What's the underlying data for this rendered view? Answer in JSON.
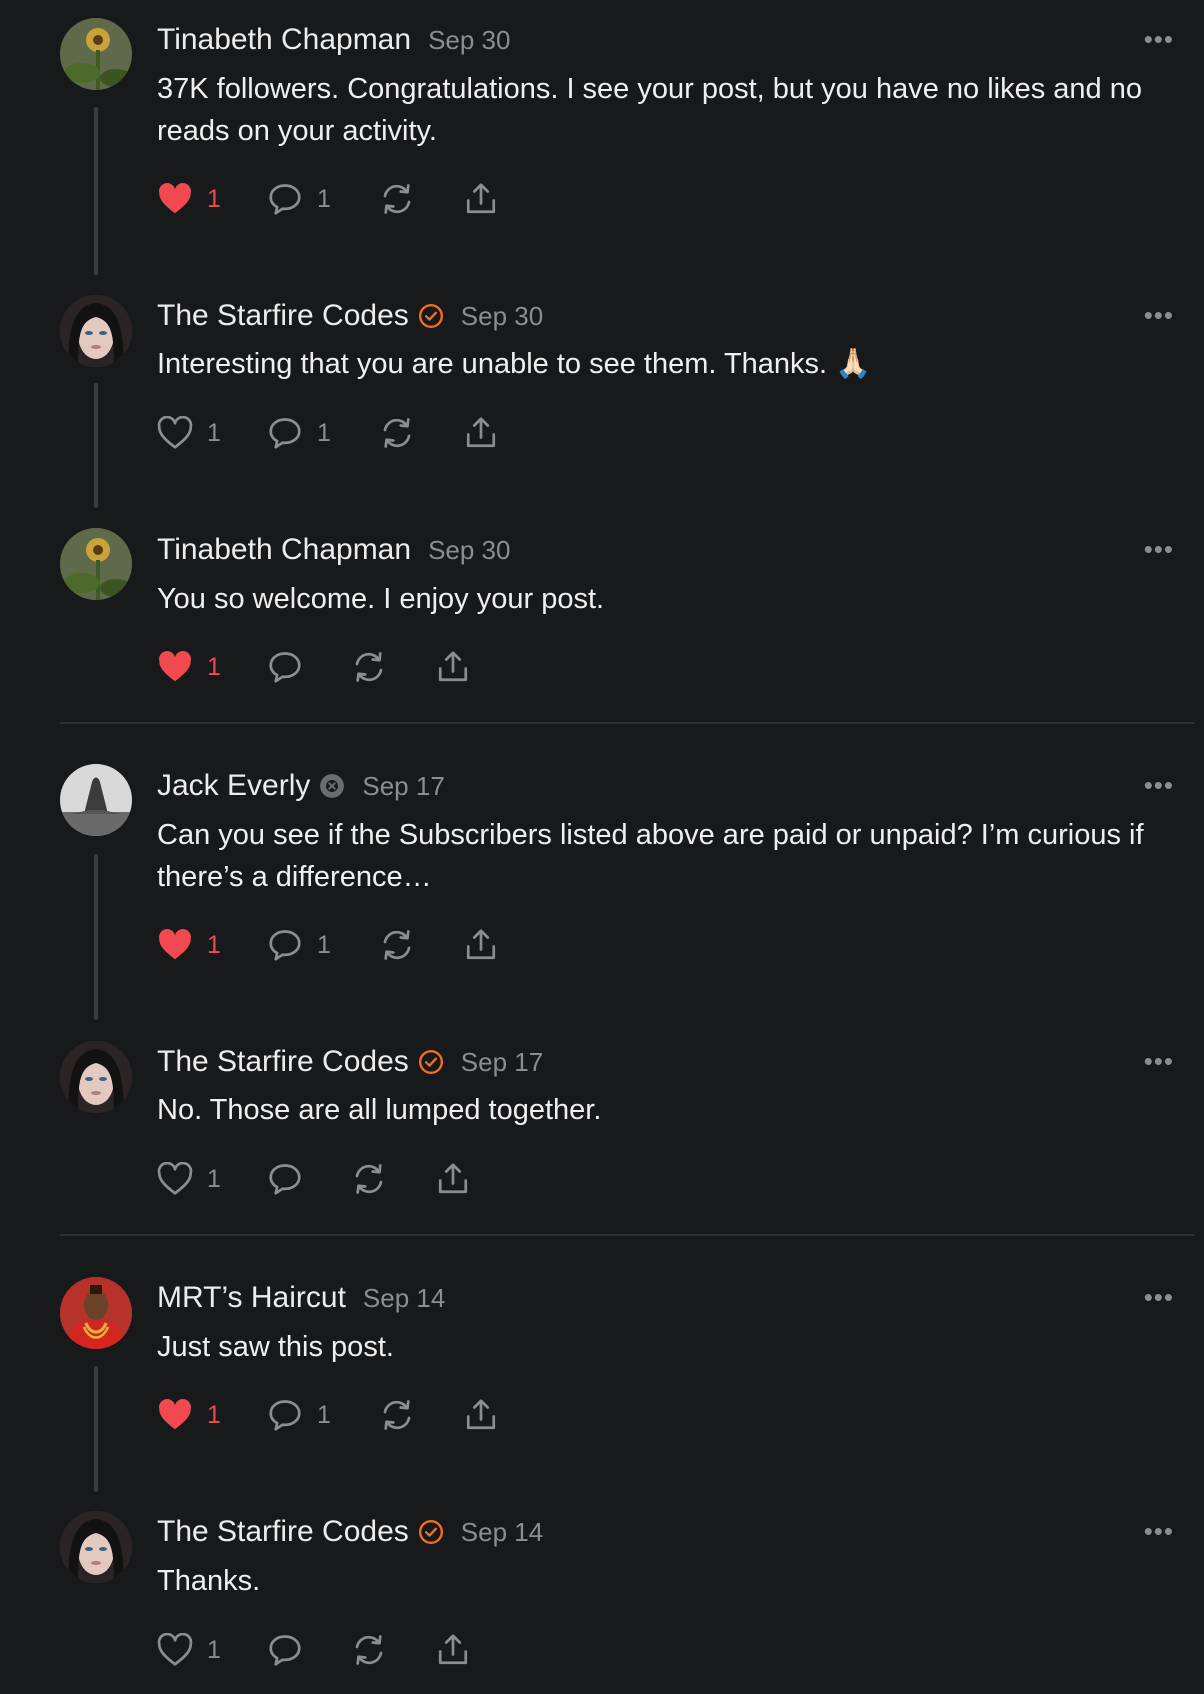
{
  "comments": [
    {
      "author": "Tinabeth Chapman",
      "date": "Sep 30",
      "text": "37K followers. Congratulations. I see your post, but you have no likes and no reads on your activity.",
      "likes": "1",
      "replies": "1",
      "liked": true,
      "badge": "",
      "avatar": "sunflower"
    },
    {
      "author": "The Starfire Codes",
      "date": "Sep 30",
      "text": "Interesting that you are unable to see them. Thanks. 🙏🏻",
      "likes": "1",
      "replies": "1",
      "liked": false,
      "badge": "verified",
      "avatar": "woman"
    },
    {
      "author": "Tinabeth Chapman",
      "date": "Sep 30",
      "text": "You so welcome. I enjoy your post.",
      "likes": "1",
      "replies": "",
      "liked": true,
      "badge": "",
      "avatar": "sunflower"
    },
    {
      "author": "Jack Everly",
      "date": "Sep 17",
      "text": "Can you see if the Subscribers listed above are paid or unpaid? I’m curious if there’s a difference…",
      "likes": "1",
      "replies": "1",
      "liked": true,
      "badge": "gray",
      "avatar": "mountain"
    },
    {
      "author": "The Starfire Codes",
      "date": "Sep 17",
      "text": "No. Those are all lumped together.",
      "likes": "1",
      "replies": "",
      "liked": false,
      "badge": "verified",
      "avatar": "woman"
    },
    {
      "author": "MRT’s Haircut",
      "date": "Sep 14",
      "text": "Just saw this post.",
      "likes": "1",
      "replies": "1",
      "liked": true,
      "badge": "",
      "avatar": "man-red"
    },
    {
      "author": "The Starfire Codes",
      "date": "Sep 14",
      "text": "Thanks.",
      "likes": "1",
      "replies": "",
      "liked": false,
      "badge": "verified",
      "avatar": "woman"
    }
  ],
  "more_label": "•••",
  "colors": {
    "like": "#f0494f",
    "verified": "#f26d24",
    "muted": "#8c8d90",
    "background": "#18191b"
  }
}
